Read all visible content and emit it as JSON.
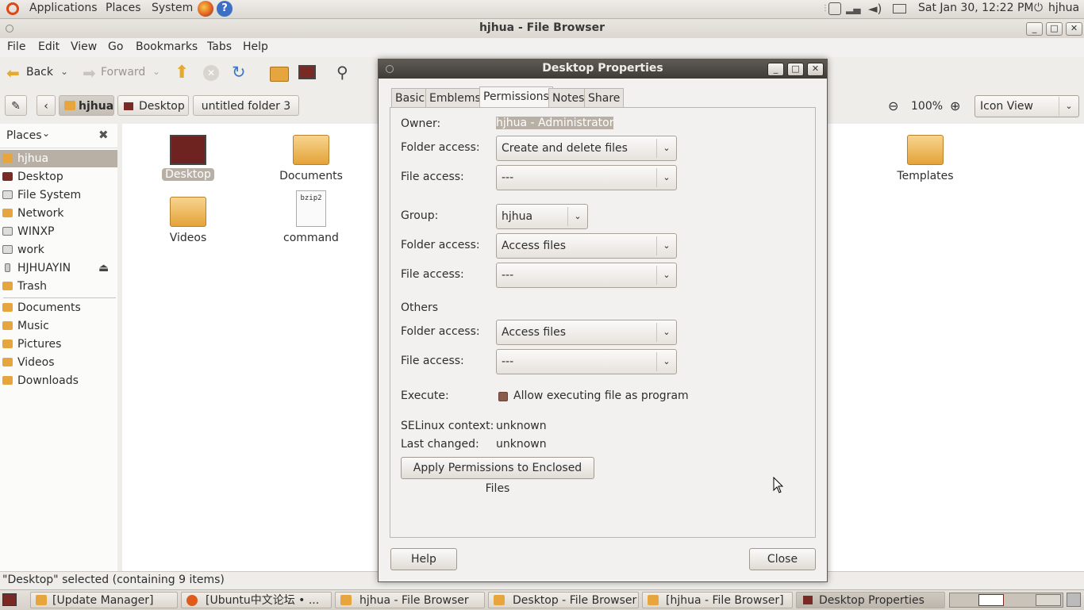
{
  "top_panel": {
    "menus": [
      "Applications",
      "Places",
      "System"
    ],
    "clock": "Sat Jan 30, 12:22 PM",
    "user": "hjhua"
  },
  "window": {
    "title": "hjhua - File Browser"
  },
  "menubar": [
    "File",
    "Edit",
    "View",
    "Go",
    "Bookmarks",
    "Tabs",
    "Help"
  ],
  "toolbar": {
    "back": "Back",
    "forward": "Forward"
  },
  "locationbar": {
    "crumbs": [
      "hjhua",
      "Desktop",
      "untitled folder 3"
    ],
    "zoom": "100%",
    "view_mode": "Icon View"
  },
  "sidebar": {
    "header": "Places",
    "items": [
      "hjhua",
      "Desktop",
      "File System",
      "Network",
      "WINXP",
      "work",
      "HJHUAYIN",
      "Trash"
    ],
    "bookmarks": [
      "Documents",
      "Music",
      "Pictures",
      "Videos",
      "Downloads"
    ]
  },
  "files": [
    {
      "name": "Desktop"
    },
    {
      "name": "Documents"
    },
    {
      "name": "Templates"
    },
    {
      "name": "Videos"
    },
    {
      "name": "command",
      "badge": "bzip2"
    }
  ],
  "statusbar": {
    "text": "\"Desktop\" selected (containing 9 items)"
  },
  "dialog": {
    "title": "Desktop Properties",
    "tabs": [
      "Basic",
      "Emblems",
      "Permissions",
      "Notes",
      "Share"
    ],
    "owner_label": "Owner:",
    "owner_value": "hjhua - Administrator",
    "folder_access_label": "Folder access:",
    "file_access_label": "File access:",
    "owner_folder_access": "Create and delete files",
    "owner_file_access": "---",
    "group_label": "Group:",
    "group_value": "hjhua",
    "group_folder_access": "Access files",
    "group_file_access": "---",
    "others_label": "Others",
    "others_folder_access": "Access files",
    "others_file_access": "---",
    "execute_label": "Execute:",
    "execute_checkbox": "Allow executing file as program",
    "selinux_label": "SELinux context:",
    "selinux_value": "unknown",
    "last_changed_label": "Last changed:",
    "last_changed_value": "unknown",
    "apply_button": "Apply Permissions to Enclosed Files",
    "help_button": "Help",
    "close_button": "Close"
  },
  "taskbar": [
    "[Update Manager]",
    "[Ubuntu中文论坛 • ...",
    "hjhua - File Browser",
    "Desktop - File Browser",
    "[hjhua - File Browser]",
    "Desktop Properties"
  ]
}
